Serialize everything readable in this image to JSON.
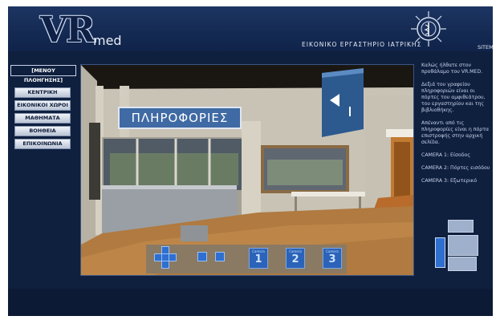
{
  "header": {
    "logo_main": "VR",
    "logo_sub": "med",
    "lab_title": "ΕΙΚΟΝΙΚΟ ΕΡΓΑΣΤΗΡΙΟ ΙΑΤΡΙΚΗΣ",
    "sitemap": "SITEMAP"
  },
  "nav": {
    "title": "[ΜΕΝΟΥ ΠΛΟΗΓΗΣΗΣ]",
    "items": [
      {
        "label": "ΚΕΝΤΡΙΚΗ"
      },
      {
        "label": "ΕΙΚΟΝΙΚΟΙ ΧΩΡΟΙ"
      },
      {
        "label": "ΜΑΘΗΜΑΤΑ"
      },
      {
        "label": "ΒΟΗΘΕΙΑ"
      },
      {
        "label": "ΕΠΙΚΟΙΝΩΝΙΑ"
      }
    ]
  },
  "scene": {
    "sign": "ΠΛΗΡΟΦΟΡΙΕΣ"
  },
  "cameras": [
    {
      "label": "Camera",
      "number": "1"
    },
    {
      "label": "Camera",
      "number": "2"
    },
    {
      "label": "Camera",
      "number": "3"
    }
  ],
  "info": {
    "paragraphs": [
      "Καλώς ήλθατε στον προθάλαμο του VR.MED.",
      "Δεξιά του γραφείου πληροφοριών είναι οι πόρτες του αμφιθεάτρου, του εργαστηρίου και της βιβλιοθήκης.",
      "Απέναντι από τις πληροφορίες είναι η πόρτα επιστροφής στην αρχική σελίδα.",
      "CAMERA 1: Είσοδος",
      "CAMERA 2: Πόρτες εισόδου",
      "CAMERA 3: Εξωτερικό"
    ]
  },
  "colors": {
    "background": "#0f1f3e",
    "accent": "#2e6fd0"
  }
}
